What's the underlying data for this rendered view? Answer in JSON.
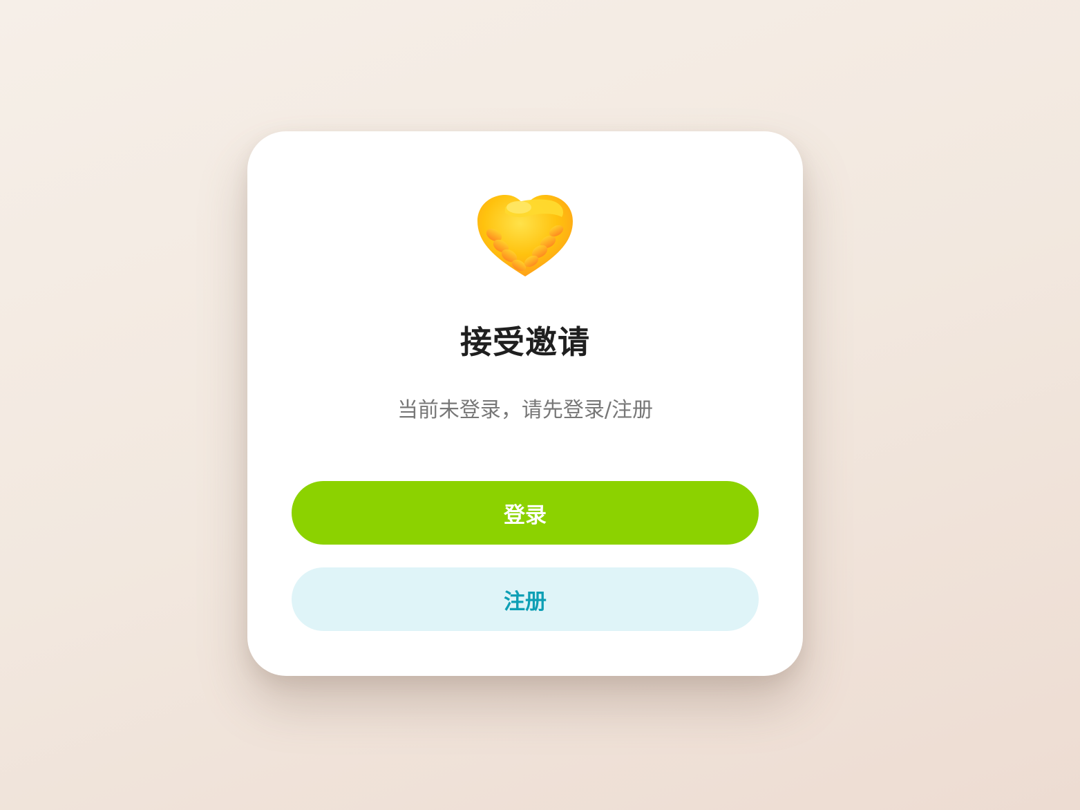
{
  "dialog": {
    "icon": "handshake-heart-icon",
    "title": "接受邀请",
    "message": "当前未登录，请先登录/注册",
    "login_label": "登录",
    "register_label": "注册"
  },
  "colors": {
    "primary_button": "#8cd200",
    "secondary_button_bg": "#dff4f8",
    "secondary_button_text": "#0e9fb5",
    "title_text": "#1f1f1f",
    "message_text": "#777777"
  }
}
